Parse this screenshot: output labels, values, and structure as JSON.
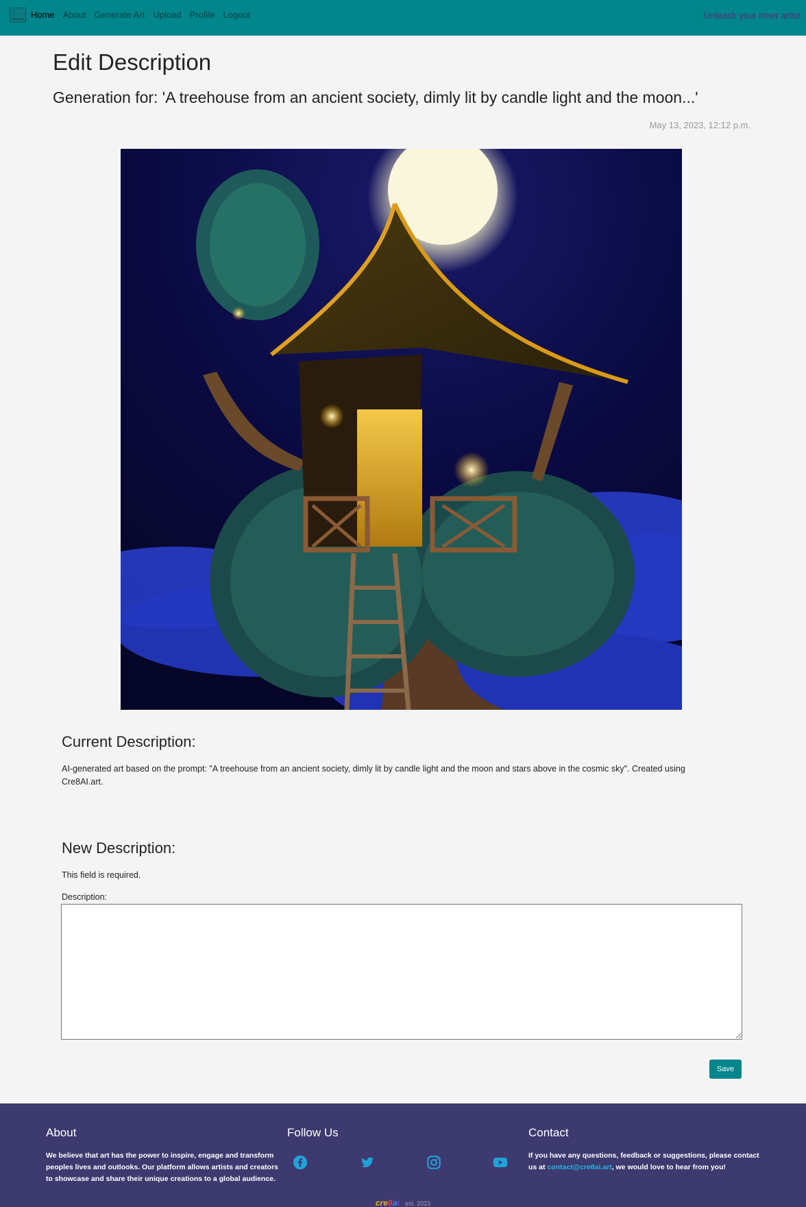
{
  "nav": {
    "items": [
      {
        "label": "Home",
        "active": true
      },
      {
        "label": "About",
        "active": false
      },
      {
        "label": "Generate Art",
        "active": false
      },
      {
        "label": "Upload",
        "active": false
      },
      {
        "label": "Profile",
        "active": false
      },
      {
        "label": "Logout",
        "active": false
      }
    ],
    "tagline": "Unleash your inner artist",
    "colors": {
      "bar": "#00868b",
      "tagline": "#5a2a7a"
    }
  },
  "page": {
    "title": "Edit Description",
    "generation_title": "Generation for: 'A treehouse from an ancient society, dimly lit by candle light and the moon...'",
    "date": "May 13, 2023, 12:12 p.m."
  },
  "current": {
    "heading": "Current Description:",
    "text": "AI-generated art based on the prompt: \"A treehouse from an ancient society, dimly lit by candle light and the moon and stars above in the cosmic sky\". Created using Cre8AI.art."
  },
  "new_desc": {
    "heading": "New Description:",
    "required_msg": "This field is required.",
    "label": "Description:",
    "value": "",
    "save_label": "Save"
  },
  "footer": {
    "about": {
      "heading": "About",
      "text": "We believe that art has the power to inspire, engage and transform peoples lives and outlooks. Our platform allows artists and creators to showcase and share their unique creations to a global audience."
    },
    "follow": {
      "heading": "Follow Us",
      "icons": [
        "facebook-icon",
        "twitter-icon",
        "instagram-icon",
        "youtube-icon"
      ],
      "icon_color": "#1fa3d8"
    },
    "contact": {
      "heading": "Contact",
      "text_before": "If you have any questions, feedback or suggestions, please contact us at ",
      "email": "contact@cre8ai.art",
      "text_after": ", we would love to hear from you!"
    },
    "brand": {
      "logo_parts": [
        "cre",
        "8",
        "a",
        "i"
      ],
      "est": "est. 2023"
    },
    "colors": {
      "background": "#3d3a6f",
      "link": "#23b5e0"
    }
  }
}
